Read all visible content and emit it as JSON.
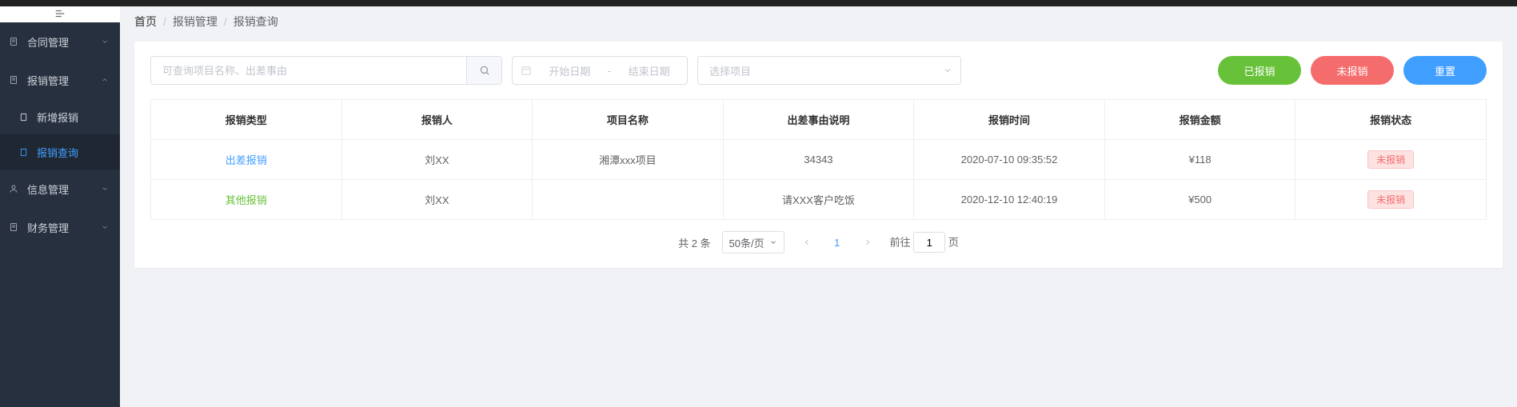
{
  "breadcrumb": {
    "home": "首页",
    "mid": "报销管理",
    "leaf": "报销查询"
  },
  "sidebar": {
    "groups": [
      {
        "label": "合同管理"
      },
      {
        "label": "报销管理"
      },
      {
        "label": "信息管理"
      },
      {
        "label": "财务管理"
      }
    ],
    "subs": [
      {
        "label": "新增报销"
      },
      {
        "label": "报销查询"
      }
    ]
  },
  "toolbar": {
    "search_placeholder": "可查询项目名称、出差事由",
    "date_start": "开始日期",
    "date_end": "结束日期",
    "project_placeholder": "选择项目",
    "btn_done": "已报销",
    "btn_undone": "未报销",
    "btn_reset": "重置"
  },
  "table": {
    "headers": [
      "报销类型",
      "报销人",
      "项目名称",
      "出差事由说明",
      "报销时间",
      "报销金额",
      "报销状态"
    ],
    "rows": [
      {
        "type": "出差报销",
        "type_color": "blue",
        "person": "刘XX",
        "project": "湘潭xxx项目",
        "reason": "34343",
        "time": "2020-07-10 09:35:52",
        "amount": "¥118",
        "status": "未报销"
      },
      {
        "type": "其他报销",
        "type_color": "green",
        "person": "刘XX",
        "project": "",
        "reason": "请XXX客户吃饭",
        "time": "2020-12-10 12:40:19",
        "amount": "¥500",
        "status": "未报销"
      }
    ]
  },
  "pagination": {
    "total_label": "共 2 条",
    "page_size": "50条/页",
    "current": "1",
    "jump_prefix": "前往",
    "jump_suffix": "页",
    "jump_value": "1"
  }
}
